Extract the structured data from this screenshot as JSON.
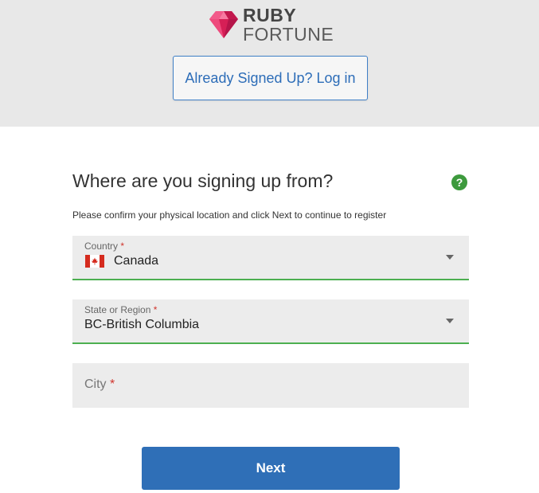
{
  "brand": {
    "logo_word1": "RUBY",
    "logo_word2": "FORTUNE",
    "gem_icon": "ruby-gem-icon",
    "accent_color": "#e0245e"
  },
  "header": {
    "login_label": "Already Signed Up? Log in"
  },
  "form": {
    "heading": "Where are you signing up from?",
    "help_icon": "question-mark",
    "subtext": "Please confirm your physical location and click Next to continue to register",
    "country": {
      "label": "Country",
      "required_mark": "*",
      "value": "Canada",
      "flag_icon": "canada-flag-icon"
    },
    "state": {
      "label": "State or Region",
      "required_mark": "*",
      "value": "BC-British Columbia"
    },
    "city": {
      "placeholder": "City",
      "required_mark": "*",
      "value": ""
    },
    "next_label": "Next"
  },
  "colors": {
    "primary": "#2f6fb7",
    "valid_underline": "#4caf50",
    "required": "#d0342c",
    "header_band": "#e8e8e8"
  }
}
